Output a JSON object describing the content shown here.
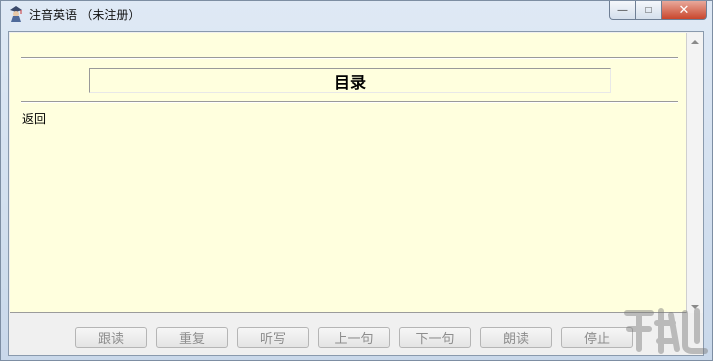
{
  "window": {
    "title": "注音英语 （未注册）",
    "caption_buttons": {
      "minimize": "—",
      "maximize": "□",
      "close": "✕"
    }
  },
  "content": {
    "toc_title": "目录",
    "back_link": "返回"
  },
  "toolbar": {
    "buttons": [
      "跟读",
      "重复",
      "听写",
      "上一句",
      "下一句",
      "朗读",
      "停止"
    ]
  },
  "colors": {
    "content_bg": "#ffffde",
    "button_text_disabled": "#8d8d8d"
  },
  "icons": {
    "app": "scholar-icon",
    "scroll_up": "scroll-up-arrow-icon",
    "scroll_down": "scroll-down-arrow-icon",
    "watermark": "watermark-logo"
  }
}
